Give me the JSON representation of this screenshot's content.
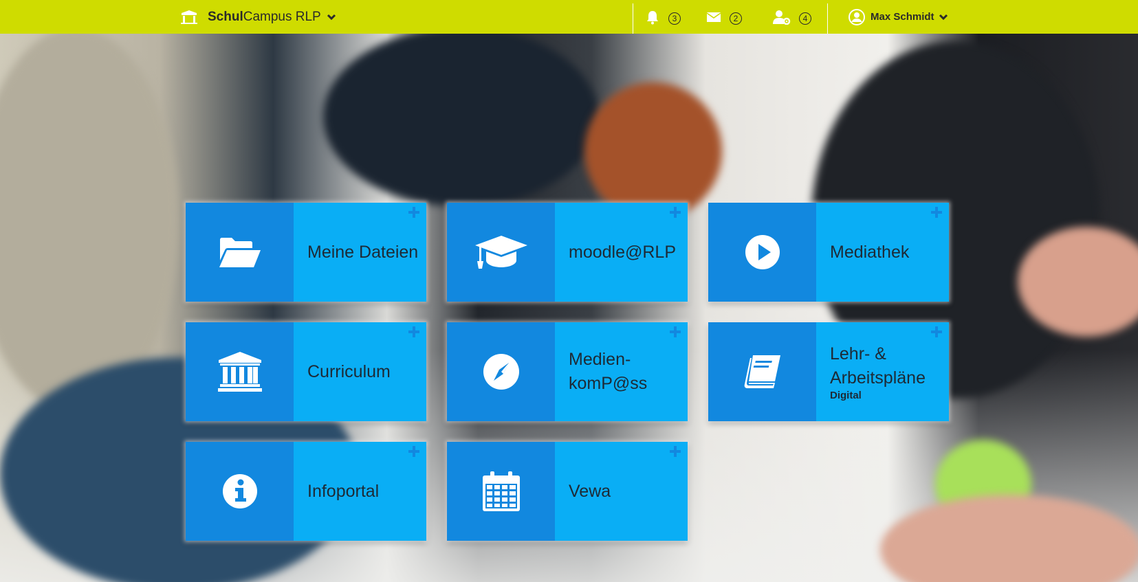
{
  "header": {
    "brand_bold": "Schul",
    "brand_rest": "Campus RLP",
    "notifications_count": "3",
    "messages_count": "2",
    "user_admin_count": "4",
    "user_name": "Max Schmidt"
  },
  "colors": {
    "topbar": "#cfdc00",
    "tile_icon_bg": "#1288df",
    "tile_label_bg": "#0aaef5"
  },
  "tiles": [
    {
      "label": "Meine Dateien",
      "icon": "folder-open-icon"
    },
    {
      "label": "moodle@RLP",
      "icon": "graduation-cap-icon"
    },
    {
      "label": "Mediathek",
      "icon": "play-circle-icon"
    },
    {
      "label": "Curriculum",
      "icon": "institution-icon"
    },
    {
      "label_line1": "Medien-",
      "label_line2": "komP@ss",
      "icon": "compass-icon"
    },
    {
      "label_line1": "Lehr- &",
      "label_line2": "Arbeitspläne",
      "sublabel": "Digital",
      "icon": "book-icon"
    },
    {
      "label": "Infoportal",
      "icon": "info-circle-icon"
    },
    {
      "label": "Vewa",
      "icon": "calendar-icon"
    }
  ]
}
